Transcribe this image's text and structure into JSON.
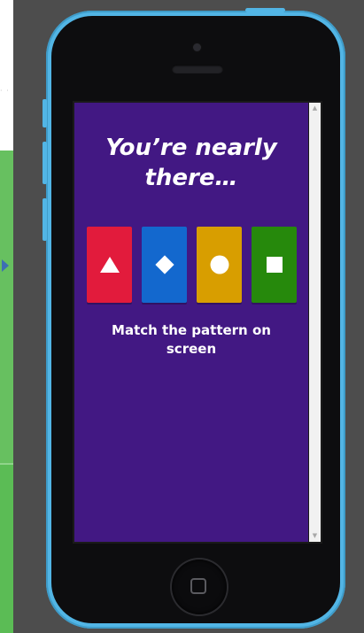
{
  "screen": {
    "title": "You’re nearly there…",
    "instruction": "Match the pattern on screen",
    "tiles": [
      {
        "icon": "triangle-icon",
        "color": "#e21b3c"
      },
      {
        "icon": "diamond-icon",
        "color": "#1368ce"
      },
      {
        "icon": "circle-icon",
        "color": "#d89e00"
      },
      {
        "icon": "square-icon",
        "color": "#26890c"
      }
    ],
    "background_color": "#421883"
  },
  "scrollbar": {
    "up_arrow": "▲",
    "down_arrow": "▼"
  },
  "left_panel": {
    "dots": "· · · ·"
  },
  "device": {
    "frame_color": "#52b5e5"
  }
}
